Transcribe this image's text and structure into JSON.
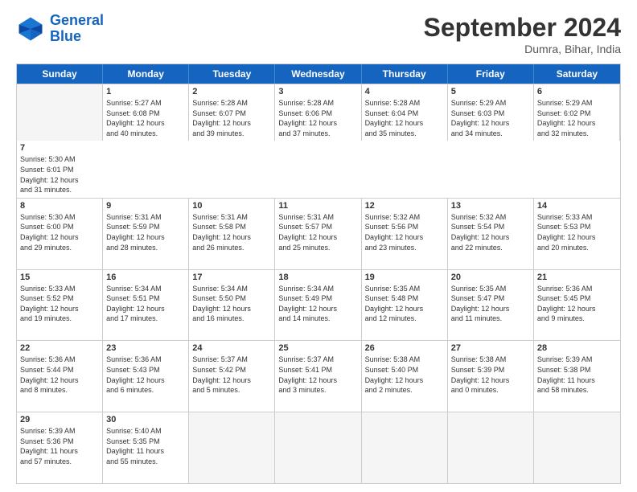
{
  "header": {
    "logo_general": "General",
    "logo_blue": "Blue",
    "month_title": "September 2024",
    "location": "Dumra, Bihar, India"
  },
  "weekdays": [
    "Sunday",
    "Monday",
    "Tuesday",
    "Wednesday",
    "Thursday",
    "Friday",
    "Saturday"
  ],
  "rows": [
    [
      {
        "day": "",
        "empty": true
      },
      {
        "day": "1",
        "lines": [
          "Sunrise: 5:27 AM",
          "Sunset: 6:08 PM",
          "Daylight: 12 hours",
          "and 40 minutes."
        ]
      },
      {
        "day": "2",
        "lines": [
          "Sunrise: 5:28 AM",
          "Sunset: 6:07 PM",
          "Daylight: 12 hours",
          "and 39 minutes."
        ]
      },
      {
        "day": "3",
        "lines": [
          "Sunrise: 5:28 AM",
          "Sunset: 6:06 PM",
          "Daylight: 12 hours",
          "and 37 minutes."
        ]
      },
      {
        "day": "4",
        "lines": [
          "Sunrise: 5:28 AM",
          "Sunset: 6:04 PM",
          "Daylight: 12 hours",
          "and 35 minutes."
        ]
      },
      {
        "day": "5",
        "lines": [
          "Sunrise: 5:29 AM",
          "Sunset: 6:03 PM",
          "Daylight: 12 hours",
          "and 34 minutes."
        ]
      },
      {
        "day": "6",
        "lines": [
          "Sunrise: 5:29 AM",
          "Sunset: 6:02 PM",
          "Daylight: 12 hours",
          "and 32 minutes."
        ]
      },
      {
        "day": "7",
        "lines": [
          "Sunrise: 5:30 AM",
          "Sunset: 6:01 PM",
          "Daylight: 12 hours",
          "and 31 minutes."
        ]
      }
    ],
    [
      {
        "day": "8",
        "lines": [
          "Sunrise: 5:30 AM",
          "Sunset: 6:00 PM",
          "Daylight: 12 hours",
          "and 29 minutes."
        ]
      },
      {
        "day": "9",
        "lines": [
          "Sunrise: 5:31 AM",
          "Sunset: 5:59 PM",
          "Daylight: 12 hours",
          "and 28 minutes."
        ]
      },
      {
        "day": "10",
        "lines": [
          "Sunrise: 5:31 AM",
          "Sunset: 5:58 PM",
          "Daylight: 12 hours",
          "and 26 minutes."
        ]
      },
      {
        "day": "11",
        "lines": [
          "Sunrise: 5:31 AM",
          "Sunset: 5:57 PM",
          "Daylight: 12 hours",
          "and 25 minutes."
        ]
      },
      {
        "day": "12",
        "lines": [
          "Sunrise: 5:32 AM",
          "Sunset: 5:56 PM",
          "Daylight: 12 hours",
          "and 23 minutes."
        ]
      },
      {
        "day": "13",
        "lines": [
          "Sunrise: 5:32 AM",
          "Sunset: 5:54 PM",
          "Daylight: 12 hours",
          "and 22 minutes."
        ]
      },
      {
        "day": "14",
        "lines": [
          "Sunrise: 5:33 AM",
          "Sunset: 5:53 PM",
          "Daylight: 12 hours",
          "and 20 minutes."
        ]
      }
    ],
    [
      {
        "day": "15",
        "lines": [
          "Sunrise: 5:33 AM",
          "Sunset: 5:52 PM",
          "Daylight: 12 hours",
          "and 19 minutes."
        ]
      },
      {
        "day": "16",
        "lines": [
          "Sunrise: 5:34 AM",
          "Sunset: 5:51 PM",
          "Daylight: 12 hours",
          "and 17 minutes."
        ]
      },
      {
        "day": "17",
        "lines": [
          "Sunrise: 5:34 AM",
          "Sunset: 5:50 PM",
          "Daylight: 12 hours",
          "and 16 minutes."
        ]
      },
      {
        "day": "18",
        "lines": [
          "Sunrise: 5:34 AM",
          "Sunset: 5:49 PM",
          "Daylight: 12 hours",
          "and 14 minutes."
        ]
      },
      {
        "day": "19",
        "lines": [
          "Sunrise: 5:35 AM",
          "Sunset: 5:48 PM",
          "Daylight: 12 hours",
          "and 12 minutes."
        ]
      },
      {
        "day": "20",
        "lines": [
          "Sunrise: 5:35 AM",
          "Sunset: 5:47 PM",
          "Daylight: 12 hours",
          "and 11 minutes."
        ]
      },
      {
        "day": "21",
        "lines": [
          "Sunrise: 5:36 AM",
          "Sunset: 5:45 PM",
          "Daylight: 12 hours",
          "and 9 minutes."
        ]
      }
    ],
    [
      {
        "day": "22",
        "lines": [
          "Sunrise: 5:36 AM",
          "Sunset: 5:44 PM",
          "Daylight: 12 hours",
          "and 8 minutes."
        ]
      },
      {
        "day": "23",
        "lines": [
          "Sunrise: 5:36 AM",
          "Sunset: 5:43 PM",
          "Daylight: 12 hours",
          "and 6 minutes."
        ]
      },
      {
        "day": "24",
        "lines": [
          "Sunrise: 5:37 AM",
          "Sunset: 5:42 PM",
          "Daylight: 12 hours",
          "and 5 minutes."
        ]
      },
      {
        "day": "25",
        "lines": [
          "Sunrise: 5:37 AM",
          "Sunset: 5:41 PM",
          "Daylight: 12 hours",
          "and 3 minutes."
        ]
      },
      {
        "day": "26",
        "lines": [
          "Sunrise: 5:38 AM",
          "Sunset: 5:40 PM",
          "Daylight: 12 hours",
          "and 2 minutes."
        ]
      },
      {
        "day": "27",
        "lines": [
          "Sunrise: 5:38 AM",
          "Sunset: 5:39 PM",
          "Daylight: 12 hours",
          "and 0 minutes."
        ]
      },
      {
        "day": "28",
        "lines": [
          "Sunrise: 5:39 AM",
          "Sunset: 5:38 PM",
          "Daylight: 11 hours",
          "and 58 minutes."
        ]
      }
    ],
    [
      {
        "day": "29",
        "lines": [
          "Sunrise: 5:39 AM",
          "Sunset: 5:36 PM",
          "Daylight: 11 hours",
          "and 57 minutes."
        ]
      },
      {
        "day": "30",
        "lines": [
          "Sunrise: 5:40 AM",
          "Sunset: 5:35 PM",
          "Daylight: 11 hours",
          "and 55 minutes."
        ]
      },
      {
        "day": "",
        "empty": true
      },
      {
        "day": "",
        "empty": true
      },
      {
        "day": "",
        "empty": true
      },
      {
        "day": "",
        "empty": true
      },
      {
        "day": "",
        "empty": true
      }
    ]
  ]
}
